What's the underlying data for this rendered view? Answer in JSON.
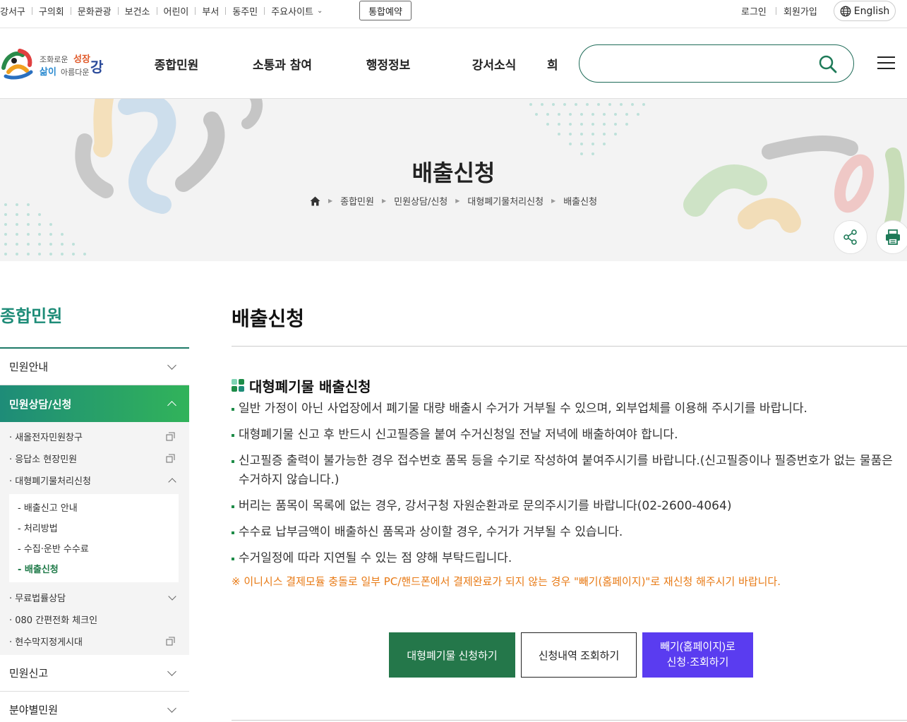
{
  "topbar": {
    "site_links": [
      "강서구",
      "구의회",
      "문화관광",
      "보건소",
      "어린이",
      "부서",
      "동주민",
      "주요사이트"
    ],
    "reserve": "통합예약",
    "login": "로그인",
    "join": "회원가입",
    "language": "English"
  },
  "header": {
    "gnb": [
      "종합민원",
      "소통과 참여",
      "행정정보",
      "강서소식",
      "희"
    ],
    "search_placeholder": ""
  },
  "visual": {
    "title": "배출신청",
    "breadcrumb": [
      "종합민원",
      "민원상담/신청",
      "대형폐기물처리신청",
      "배출신청"
    ]
  },
  "lnb": {
    "title": "종합민원",
    "menu": [
      {
        "label": "민원안내"
      },
      {
        "label": "민원상담/신청"
      },
      {
        "label": "민원신고"
      },
      {
        "label": "분야별민원"
      }
    ],
    "sub": [
      {
        "label": "새올전자민원창구"
      },
      {
        "label": "응답소 현장민원"
      },
      {
        "label": "대형폐기물처리신청"
      },
      {
        "label": "무료법률상담"
      },
      {
        "label": "080 간편전화 체크인"
      },
      {
        "label": "현수막지정게시대"
      }
    ],
    "sub3": [
      {
        "label": "배출신고 안내"
      },
      {
        "label": "처리방법"
      },
      {
        "label": "수집·운반 수수료"
      },
      {
        "label": "배출신청"
      }
    ]
  },
  "content": {
    "title": "배출신청",
    "section_title": "대형폐기물 배출신청",
    "notices": [
      "일반 가정이 아닌 사업장에서 폐기물 대량 배출시 수거가 거부될 수 있으며, 외부업체를 이용해 주시기를 바랍니다.",
      "대형폐기물 신고 후 반드시 신고필증을 붙여 수거신청일 전날 저녁에 배출하여야 합니다.",
      "신고필증 출력이 불가능한 경우 접수번호 품목 등을 수기로 작성하여 붙여주시기를 바랍니다.(신고필증이나 필증번호가 없는 물품은 수거하지 않습니다.)",
      "버리는 품목이 목록에 없는 경우, 강서구청 자원순환과로 문의주시기를 바랍니다(02-2600-4064)",
      "수수료 납부금액이 배출하신 품목과 상이할 경우, 수거가 거부될 수 있습니다.",
      "수거일정에 따라 지연될 수 있는 점 양해 부탁드립니다."
    ],
    "warning": "※ 이니시스 결제모듈 충돌로 일부 PC/핸드폰에서 결제완료가 되지 않는 경우 \"빼기(홈페이지)\"로 재신청 해주시기 바랍니다.",
    "buttons": {
      "apply": "대형폐기물 신청하기",
      "history": "신청내역 조회하기",
      "ppaegi": "빼기(홈페이지)로\n신청·조회하기"
    }
  },
  "colors": {
    "brand_green": "#24774a",
    "accent_teal": "#1e8c78",
    "ppaegi_purple": "#5a3cf0",
    "warning_orange": "#e87a15"
  }
}
